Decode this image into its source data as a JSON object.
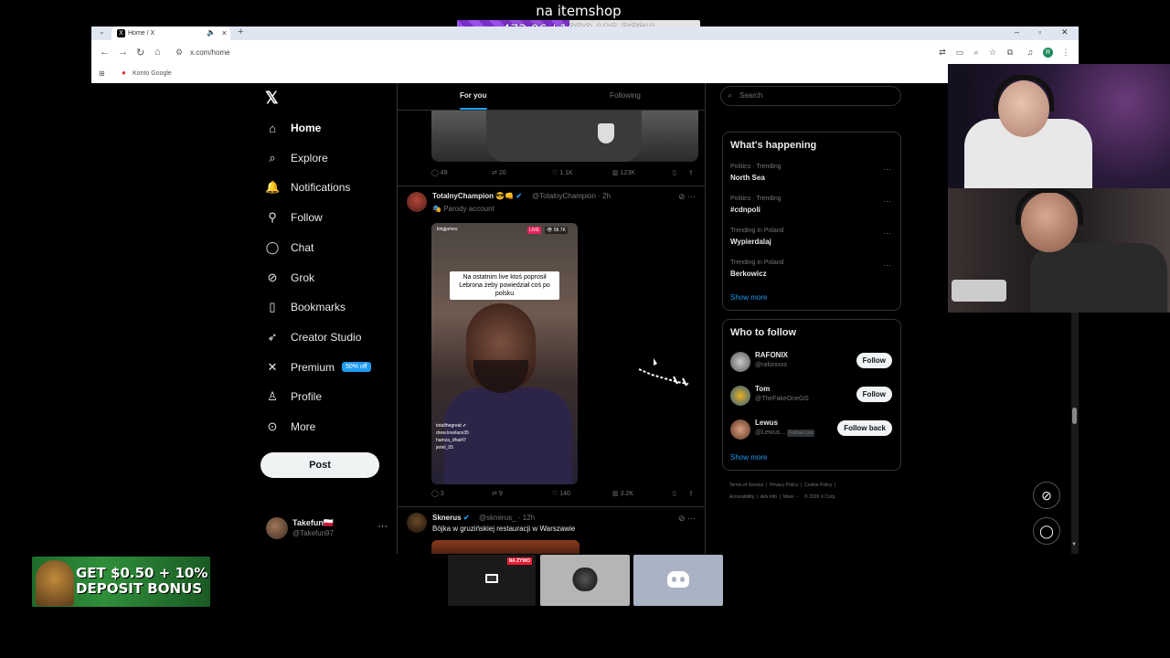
{
  "stream_goal": {
    "title": "na itemshop",
    "progress_text": "473.06 / 1020 (46.38%)",
    "progress_fraction": 0.4638
  },
  "browser": {
    "tab_title": "Home / X",
    "new_tab": "+",
    "url": "x.com/home",
    "bookmark": "Konto Google",
    "profile_initial": "R"
  },
  "x_nav": {
    "logo": "𝕏",
    "items": [
      {
        "label": "Home",
        "icon": "home-icon",
        "glyph": "⌂",
        "active": true
      },
      {
        "label": "Explore",
        "icon": "search-icon",
        "glyph": "⌕"
      },
      {
        "label": "Notifications",
        "icon": "bell-icon",
        "glyph": "🔔"
      },
      {
        "label": "Follow",
        "icon": "add-user-icon",
        "glyph": "⚲"
      },
      {
        "label": "Chat",
        "icon": "chat-icon",
        "glyph": "◯"
      },
      {
        "label": "Grok",
        "icon": "grok-icon",
        "glyph": "⊘"
      },
      {
        "label": "Bookmarks",
        "icon": "bookmark-icon",
        "glyph": "▯"
      },
      {
        "label": "Creator Studio",
        "icon": "rocket-icon",
        "glyph": "➶"
      },
      {
        "label": "Premium",
        "icon": "x-icon",
        "glyph": "✕",
        "badge": "50% off"
      },
      {
        "label": "Profile",
        "icon": "person-icon",
        "glyph": "♙"
      },
      {
        "label": "More",
        "icon": "more-circle-icon",
        "glyph": "⊙"
      }
    ],
    "post_label": "Post",
    "account": {
      "name": "Takefun🇵🇱",
      "handle": "@Takefun97"
    }
  },
  "feed": {
    "tabs": [
      "For you",
      "Following"
    ],
    "post1_actions": {
      "replies": "49",
      "reposts": "20",
      "likes": "1.1K",
      "views": "123K"
    },
    "post2": {
      "name": "TotalnyChampion 😎👊",
      "handle": "@TotalnyChampion · 2h",
      "sub": "🎭 Parody account",
      "video_caption": "Na ostatnim live ktoś poprosił Lebrona żeby powiedział coś po polsku",
      "ig_user": "kingjames",
      "live": "LIVE",
      "viewers": "👁 58.7K",
      "comments": [
        "totalthegreat ✔",
        "drew.lovelace35",
        "hamza_dhal47",
        "jeriel_05"
      ],
      "actions": {
        "replies": "3",
        "reposts": "9",
        "likes": "140",
        "views": "3.2K"
      }
    },
    "post3": {
      "name": "Sknerus",
      "handle": "@sknerus_ · 12h",
      "text": "Bójka w gruzińskiej restauracji w Warszawie"
    }
  },
  "right": {
    "search_placeholder": "Search",
    "happening_title": "What's happening",
    "trends": [
      {
        "category": "Politics · Trending",
        "name": "North Sea"
      },
      {
        "category": "Politics · Trending",
        "name": "#cdnpoli"
      },
      {
        "category": "Trending in Poland",
        "name": "Wypierdalaj"
      },
      {
        "category": "Trending in Poland",
        "name": "Berkowicz"
      }
    ],
    "show_more": "Show more",
    "who_title": "Who to follow",
    "follow_list": [
      {
        "name": "RAFONIX",
        "handle": "@rafonixxx",
        "button": "Follow"
      },
      {
        "name": "Tom",
        "handle": "@TheFakeOneGG",
        "button": "Follow"
      },
      {
        "name": "Lewus",
        "handle": "@Lewus...",
        "button": "Follow back",
        "follows_you": "Follows you"
      }
    ],
    "footer": [
      "Terms of Service",
      "Privacy Policy",
      "Cookie Policy",
      "Accessibility",
      "Ads info",
      "More ···",
      "© 2026 X Corp."
    ]
  },
  "ad": {
    "text_line1": "GET $0.50 + 10%",
    "text_line2": "DEPOSIT BONUS"
  },
  "taskbar": {
    "live_label": "NA ŻYWO"
  }
}
